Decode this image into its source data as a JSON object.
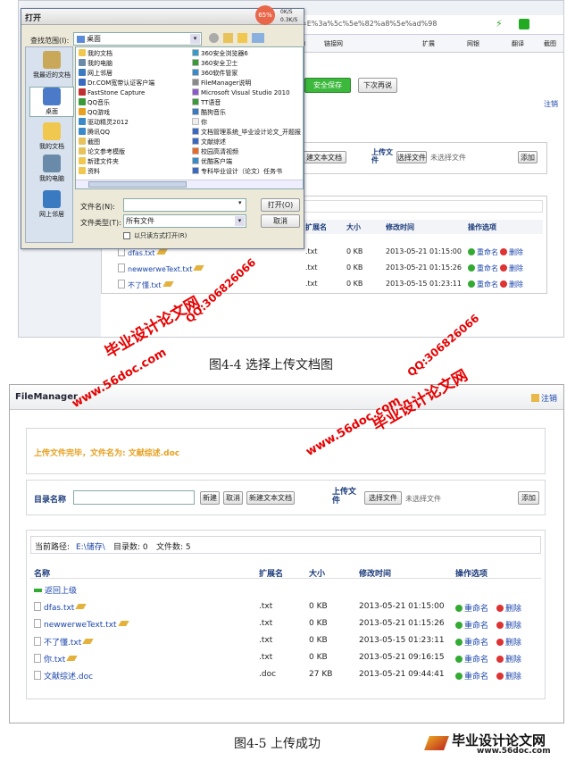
{
  "screenshot1": {
    "browser": {
      "url_fragment": "=E%3a%5c%5e%82%a8%5e%ad%98",
      "toolbar_items": [
        "物",
        "链接网",
        "扩展",
        "网银",
        "翻译",
        "截图"
      ],
      "speed_percent": "65%",
      "speed_up": "0K/S",
      "speed_down": "0.3K/S"
    },
    "page": {
      "save_button": "安全保存",
      "later_button": "下次再说",
      "logout": "注销",
      "create_text_doc": "建文本文档",
      "upload_label": "上传文件",
      "choose_file": "选择文件",
      "no_file": "未选择文件",
      "add_button": "添加",
      "columns": [
        "扩展名",
        "大小",
        "修改时间",
        "操作选项"
      ],
      "rows": [
        {
          "name": "dfas.txt",
          "ext": ".txt",
          "size": "0 KB",
          "time": "2013-05-21 01:15:00"
        },
        {
          "name": "newwerweText.txt",
          "ext": ".txt",
          "size": "0 KB",
          "time": "2013-05-21 01:15:26"
        },
        {
          "name": "不了懂.txt",
          "ext": ".txt",
          "size": "0 KB",
          "time": "2013-05-15 01:23:11"
        }
      ],
      "rename": "重命名",
      "delete": "删除"
    },
    "dialog": {
      "title": "打开",
      "lookin_label": "查找范围(I):",
      "lookin_value": "桌面",
      "places": [
        "我最近的文档",
        "桌面",
        "我的文档",
        "我的电脑",
        "网上邻居"
      ],
      "items_left": [
        "我的文档",
        "我的电脑",
        "网上邻居",
        "Dr.COM宽带认证客户端",
        "FastStone Capture",
        "QQ音乐",
        "QQ游戏",
        "驱动精灵2012",
        "腾讯QQ",
        "截图",
        "论文参考模版",
        "新建文件夹",
        "资料"
      ],
      "items_right": [
        "360安全浏览器6",
        "360安全卫士",
        "360软件管家",
        "FileManager说明",
        "Microsoft Visual Studio 2010",
        "TT语音",
        "酷狗音乐",
        "你",
        "文档管理系统_毕业设计论文_开题报",
        "文献综述",
        "校园高清视频",
        "优酷客户端",
        "专科毕业设计（论文）任务书"
      ],
      "filename_label": "文件名(N):",
      "filename_value": "",
      "filetype_label": "文件类型(T):",
      "filetype_value": "所有文件",
      "readonly_label": "以只读方式打开(R)",
      "open_button": "打开(O)",
      "cancel_button": "取消"
    },
    "caption": "图4-4  选择上传文档图"
  },
  "screenshot2": {
    "app_title": "FileManager",
    "logout": "注销",
    "success_message": "上传文件完毕，文件名为: 文献综述.doc",
    "dir_label": "目录名称",
    "new_button": "新建",
    "cancel_button": "取消",
    "new_text_button": "新建文本文档",
    "upload_label": "上传文件",
    "choose_file": "选择文件",
    "no_file": "未选择文件",
    "add_button": "添加",
    "path_label": "当前路径:",
    "path_value": "E:\\储存\\",
    "dir_count": "目录数: 0",
    "file_count": "文件数: 5",
    "columns": [
      "名称",
      "扩展名",
      "大小",
      "修改时间",
      "操作选项"
    ],
    "back_link": "返回上级",
    "rows": [
      {
        "name": "dfas.txt",
        "ext": ".txt",
        "size": "0 KB",
        "time": "2013-05-21 01:15:00"
      },
      {
        "name": "newwerweText.txt",
        "ext": ".txt",
        "size": "0 KB",
        "time": "2013-05-21 01:15:26"
      },
      {
        "name": "不了懂.txt",
        "ext": ".txt",
        "size": "0 KB",
        "time": "2013-05-15 01:23:11"
      },
      {
        "name": "你.txt",
        "ext": ".txt",
        "size": "0 KB",
        "time": "2013-05-21 09:16:15"
      },
      {
        "name": "文献综述.doc",
        "ext": ".doc",
        "size": "27 KB",
        "time": "2013-05-21 09:44:41"
      }
    ],
    "rename": "重命名",
    "delete": "删除",
    "caption": "图4-5  上传成功"
  },
  "watermarks": {
    "brand": "毕业设计论文网",
    "site": "www.56doc.com",
    "qq": "QQ:306826066",
    "footer_logo": "毕业设计论文网",
    "footer_site": "www.56doc.com"
  },
  "colors": {
    "accent_green": "#3cb83c",
    "success_text": "#e8a020",
    "watermark_red": "#e60000"
  }
}
